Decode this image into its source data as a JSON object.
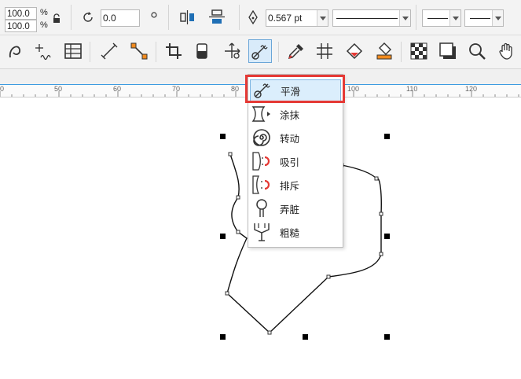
{
  "property_bar": {
    "scale_x": "100.0",
    "scale_y": "100.0",
    "percent_label": "%",
    "rotation": "0.0",
    "outline_width": "0.567 pt"
  },
  "ruler": {
    "labels": [
      "0",
      "50",
      "60",
      "70",
      "80",
      "100",
      "110",
      "120"
    ]
  },
  "tool_menu": {
    "items": [
      {
        "label": "平滑",
        "icon": "smooth-tool-icon",
        "selected": true
      },
      {
        "label": "涂抹",
        "icon": "smear-tool-icon",
        "selected": false
      },
      {
        "label": "转动",
        "icon": "twirl-tool-icon",
        "selected": false
      },
      {
        "label": "吸引",
        "icon": "attract-tool-icon",
        "selected": false
      },
      {
        "label": "排斥",
        "icon": "repel-tool-icon",
        "selected": false
      },
      {
        "label": "弄脏",
        "icon": "smudge-tool-icon",
        "selected": false
      },
      {
        "label": "粗糙",
        "icon": "roughen-tool-icon",
        "selected": false
      }
    ]
  },
  "colors": {
    "highlight": "#e53935",
    "selection": "#dbeefc",
    "ruler_line": "#3d9be0"
  }
}
